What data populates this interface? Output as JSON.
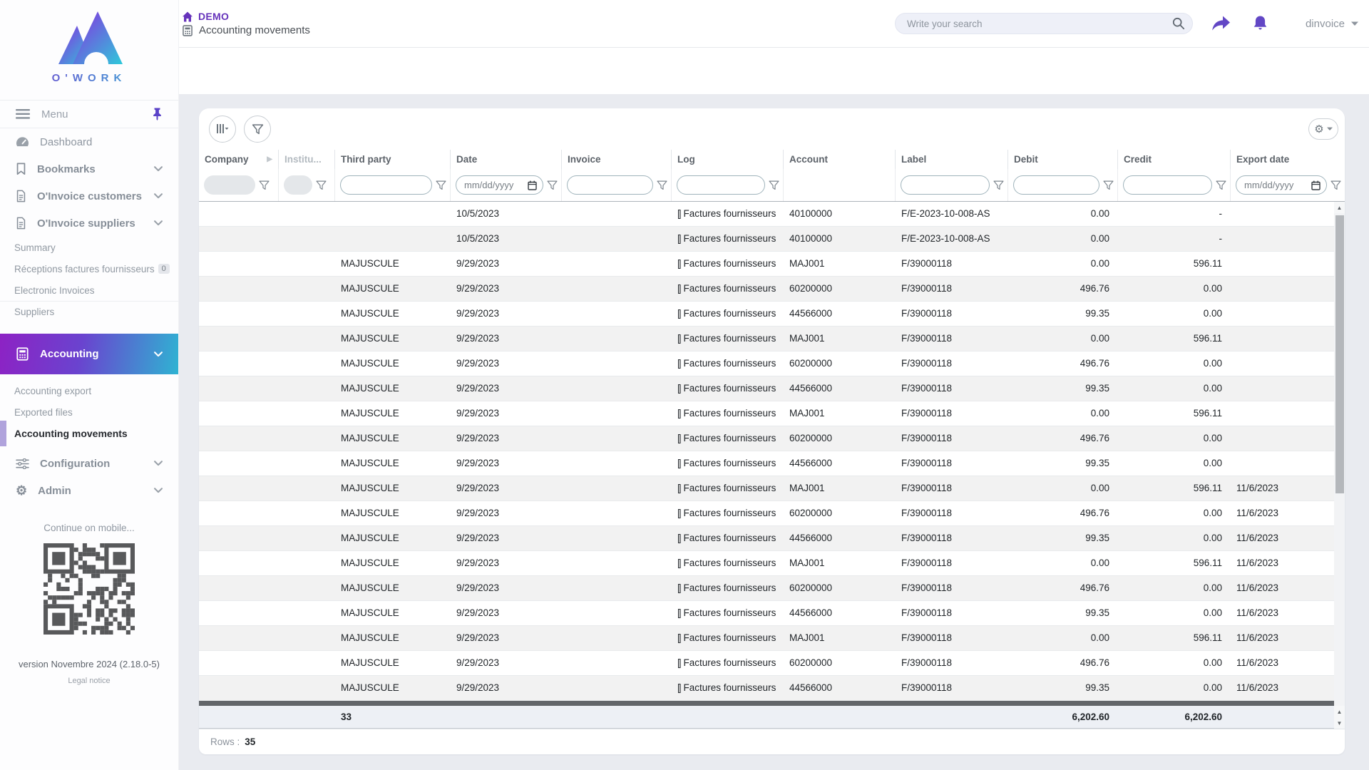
{
  "colors": {
    "accent": "#6247c5",
    "breadcrumb_purple": "#6633bb",
    "gradient_start": "#8d22c4",
    "gradient_end": "#2fb3d2",
    "active_bar": "#b0a3dc",
    "row_stripe": "#f2f2f2",
    "totals_bg": "#edf0f5",
    "content_bg": "#e9ebf0"
  },
  "brand": {
    "name": "O'WORK"
  },
  "sidebar": {
    "menu_label": "Menu",
    "items": {
      "dashboard": "Dashboard",
      "bookmarks": "Bookmarks",
      "invoice_customers": "O'Invoice customers",
      "invoice_suppliers": "O'Invoice suppliers",
      "summary": "Summary",
      "receptions": "Réceptions factures fournisseurs",
      "receptions_badge": "0",
      "electronic_invoices": "Electronic Invoices",
      "suppliers": "Suppliers",
      "accounting": "Accounting",
      "accounting_export": "Accounting export",
      "exported_files": "Exported files",
      "accounting_movements": "Accounting movements",
      "configuration": "Configuration",
      "admin": "Admin"
    },
    "mobile_hint": "Continue on mobile...",
    "version": "version Novembre 2024 (2.18.0-5)",
    "legal": "Legal notice"
  },
  "header": {
    "breadcrumb": "DEMO",
    "page_title": "Accounting movements",
    "search_placeholder": "Write your search",
    "user": "dinvoice"
  },
  "table": {
    "date_placeholder": "mm/dd/yyyy",
    "log_icon_text": "[]",
    "columns": [
      {
        "key": "company",
        "label": "Company",
        "filter": "disabled",
        "align": "left"
      },
      {
        "key": "institution",
        "label": "Institu...",
        "filter": "disabled-small",
        "align": "left"
      },
      {
        "key": "third_party",
        "label": "Third party",
        "filter": "text",
        "align": "left"
      },
      {
        "key": "date",
        "label": "Date",
        "filter": "date",
        "align": "left"
      },
      {
        "key": "invoice",
        "label": "Invoice",
        "filter": "text",
        "align": "left"
      },
      {
        "key": "log",
        "label": "Log",
        "filter": "text",
        "align": "left"
      },
      {
        "key": "account",
        "label": "Account",
        "filter": "none",
        "align": "left"
      },
      {
        "key": "label",
        "label": "Label",
        "filter": "text",
        "align": "left"
      },
      {
        "key": "debit",
        "label": "Debit",
        "filter": "text",
        "align": "right"
      },
      {
        "key": "credit",
        "label": "Credit",
        "filter": "text",
        "align": "right"
      },
      {
        "key": "export_date",
        "label": "Export date",
        "filter": "date",
        "align": "left"
      }
    ],
    "rows": [
      {
        "company": "",
        "institution": "",
        "third_party": "",
        "date": "10/5/2023",
        "invoice": "",
        "log": "Factures fournisseurs",
        "account": "40100000",
        "label": "F/E-2023-10-008-AS",
        "debit": "0.00",
        "credit": "-",
        "export_date": ""
      },
      {
        "company": "",
        "institution": "",
        "third_party": "",
        "date": "10/5/2023",
        "invoice": "",
        "log": "Factures fournisseurs",
        "account": "40100000",
        "label": "F/E-2023-10-008-AS",
        "debit": "0.00",
        "credit": "-",
        "export_date": ""
      },
      {
        "company": "",
        "institution": "",
        "third_party": "MAJUSCULE",
        "date": "9/29/2023",
        "invoice": "",
        "log": "Factures fournisseurs",
        "account": "MAJ001",
        "label": "F/39000118",
        "debit": "0.00",
        "credit": "596.11",
        "export_date": ""
      },
      {
        "company": "",
        "institution": "",
        "third_party": "MAJUSCULE",
        "date": "9/29/2023",
        "invoice": "",
        "log": "Factures fournisseurs",
        "account": "60200000",
        "label": "F/39000118",
        "debit": "496.76",
        "credit": "0.00",
        "export_date": ""
      },
      {
        "company": "",
        "institution": "",
        "third_party": "MAJUSCULE",
        "date": "9/29/2023",
        "invoice": "",
        "log": "Factures fournisseurs",
        "account": "44566000",
        "label": "F/39000118",
        "debit": "99.35",
        "credit": "0.00",
        "export_date": ""
      },
      {
        "company": "",
        "institution": "",
        "third_party": "MAJUSCULE",
        "date": "9/29/2023",
        "invoice": "",
        "log": "Factures fournisseurs",
        "account": "MAJ001",
        "label": "F/39000118",
        "debit": "0.00",
        "credit": "596.11",
        "export_date": ""
      },
      {
        "company": "",
        "institution": "",
        "third_party": "MAJUSCULE",
        "date": "9/29/2023",
        "invoice": "",
        "log": "Factures fournisseurs",
        "account": "60200000",
        "label": "F/39000118",
        "debit": "496.76",
        "credit": "0.00",
        "export_date": ""
      },
      {
        "company": "",
        "institution": "",
        "third_party": "MAJUSCULE",
        "date": "9/29/2023",
        "invoice": "",
        "log": "Factures fournisseurs",
        "account": "44566000",
        "label": "F/39000118",
        "debit": "99.35",
        "credit": "0.00",
        "export_date": ""
      },
      {
        "company": "",
        "institution": "",
        "third_party": "MAJUSCULE",
        "date": "9/29/2023",
        "invoice": "",
        "log": "Factures fournisseurs",
        "account": "MAJ001",
        "label": "F/39000118",
        "debit": "0.00",
        "credit": "596.11",
        "export_date": ""
      },
      {
        "company": "",
        "institution": "",
        "third_party": "MAJUSCULE",
        "date": "9/29/2023",
        "invoice": "",
        "log": "Factures fournisseurs",
        "account": "60200000",
        "label": "F/39000118",
        "debit": "496.76",
        "credit": "0.00",
        "export_date": ""
      },
      {
        "company": "",
        "institution": "",
        "third_party": "MAJUSCULE",
        "date": "9/29/2023",
        "invoice": "",
        "log": "Factures fournisseurs",
        "account": "44566000",
        "label": "F/39000118",
        "debit": "99.35",
        "credit": "0.00",
        "export_date": ""
      },
      {
        "company": "",
        "institution": "",
        "third_party": "MAJUSCULE",
        "date": "9/29/2023",
        "invoice": "",
        "log": "Factures fournisseurs",
        "account": "MAJ001",
        "label": "F/39000118",
        "debit": "0.00",
        "credit": "596.11",
        "export_date": "11/6/2023"
      },
      {
        "company": "",
        "institution": "",
        "third_party": "MAJUSCULE",
        "date": "9/29/2023",
        "invoice": "",
        "log": "Factures fournisseurs",
        "account": "60200000",
        "label": "F/39000118",
        "debit": "496.76",
        "credit": "0.00",
        "export_date": "11/6/2023"
      },
      {
        "company": "",
        "institution": "",
        "third_party": "MAJUSCULE",
        "date": "9/29/2023",
        "invoice": "",
        "log": "Factures fournisseurs",
        "account": "44566000",
        "label": "F/39000118",
        "debit": "99.35",
        "credit": "0.00",
        "export_date": "11/6/2023"
      },
      {
        "company": "",
        "institution": "",
        "third_party": "MAJUSCULE",
        "date": "9/29/2023",
        "invoice": "",
        "log": "Factures fournisseurs",
        "account": "MAJ001",
        "label": "F/39000118",
        "debit": "0.00",
        "credit": "596.11",
        "export_date": "11/6/2023"
      },
      {
        "company": "",
        "institution": "",
        "third_party": "MAJUSCULE",
        "date": "9/29/2023",
        "invoice": "",
        "log": "Factures fournisseurs",
        "account": "60200000",
        "label": "F/39000118",
        "debit": "496.76",
        "credit": "0.00",
        "export_date": "11/6/2023"
      },
      {
        "company": "",
        "institution": "",
        "third_party": "MAJUSCULE",
        "date": "9/29/2023",
        "invoice": "",
        "log": "Factures fournisseurs",
        "account": "44566000",
        "label": "F/39000118",
        "debit": "99.35",
        "credit": "0.00",
        "export_date": "11/6/2023"
      },
      {
        "company": "",
        "institution": "",
        "third_party": "MAJUSCULE",
        "date": "9/29/2023",
        "invoice": "",
        "log": "Factures fournisseurs",
        "account": "MAJ001",
        "label": "F/39000118",
        "debit": "0.00",
        "credit": "596.11",
        "export_date": "11/6/2023"
      },
      {
        "company": "",
        "institution": "",
        "third_party": "MAJUSCULE",
        "date": "9/29/2023",
        "invoice": "",
        "log": "Factures fournisseurs",
        "account": "60200000",
        "label": "F/39000118",
        "debit": "496.76",
        "credit": "0.00",
        "export_date": "11/6/2023"
      },
      {
        "company": "",
        "institution": "",
        "third_party": "MAJUSCULE",
        "date": "9/29/2023",
        "invoice": "",
        "log": "Factures fournisseurs",
        "account": "44566000",
        "label": "F/39000118",
        "debit": "99.35",
        "credit": "0.00",
        "export_date": "11/6/2023"
      }
    ],
    "totals": {
      "third_party": "33",
      "debit": "6,202.60",
      "credit": "6,202.60"
    },
    "footer": {
      "rows_label": "Rows :",
      "rows_value": "35"
    }
  }
}
